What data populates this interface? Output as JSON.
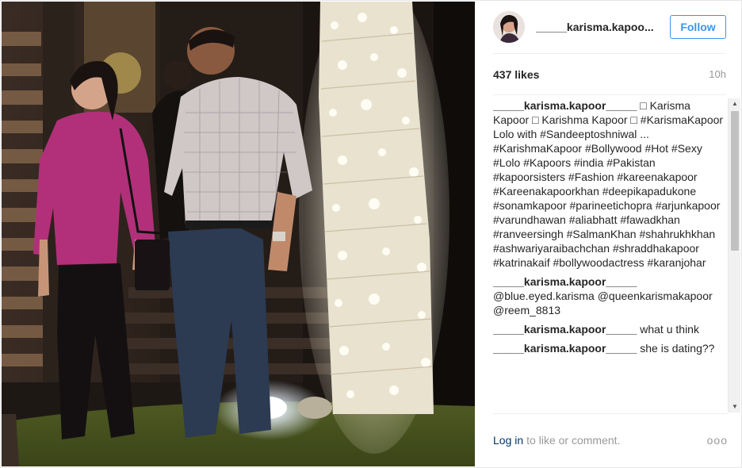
{
  "post": {
    "username": "_____karisma.kapoo...",
    "follow_label": "Follow",
    "likes": "437 likes",
    "time_ago": "10h"
  },
  "comments": [
    {
      "user": "_____karisma.kapoor_____",
      "text": " □ Karisma Kapoor □ Karishma Kapoor □ #KarismaKapoor Lolo with #Sandeeptoshniwal ... #KarishmaKapoor #Bollywood #Hot #Sexy #Lolo #Kapoors #india #Pakistan #kapoorsisters #Fashion #kareenakapoor #Kareenakapoorkhan #deepikapadukone #sonamkapoor #parineetichopra #arjunkapoor #varundhawan #aliabhatt #fawadkhan #ranveersingh #SalmanKhan #shahrukhkhan #ashwariyaraibachchan #shraddhakapoor #katrinakaif #bollywoodactress #karanjohar"
    },
    {
      "user": "_____karisma.kapoor_____",
      "text": " @blue.eyed.karisma @queenkarismakapoor @reem_8813"
    },
    {
      "user": "_____karisma.kapoor_____",
      "text": " what u think"
    },
    {
      "user": "_____karisma.kapoor_____",
      "text": " she is dating??"
    }
  ],
  "footer": {
    "login_label": "Log in",
    "login_rest": "to like or comment.",
    "more_label": "ooo"
  },
  "icons": {
    "scroll_up": "triangle-up",
    "scroll_down": "triangle-down",
    "more": "ellipsis"
  },
  "colors": {
    "accent": "#3897f0",
    "link": "#003569",
    "muted": "#999999"
  }
}
